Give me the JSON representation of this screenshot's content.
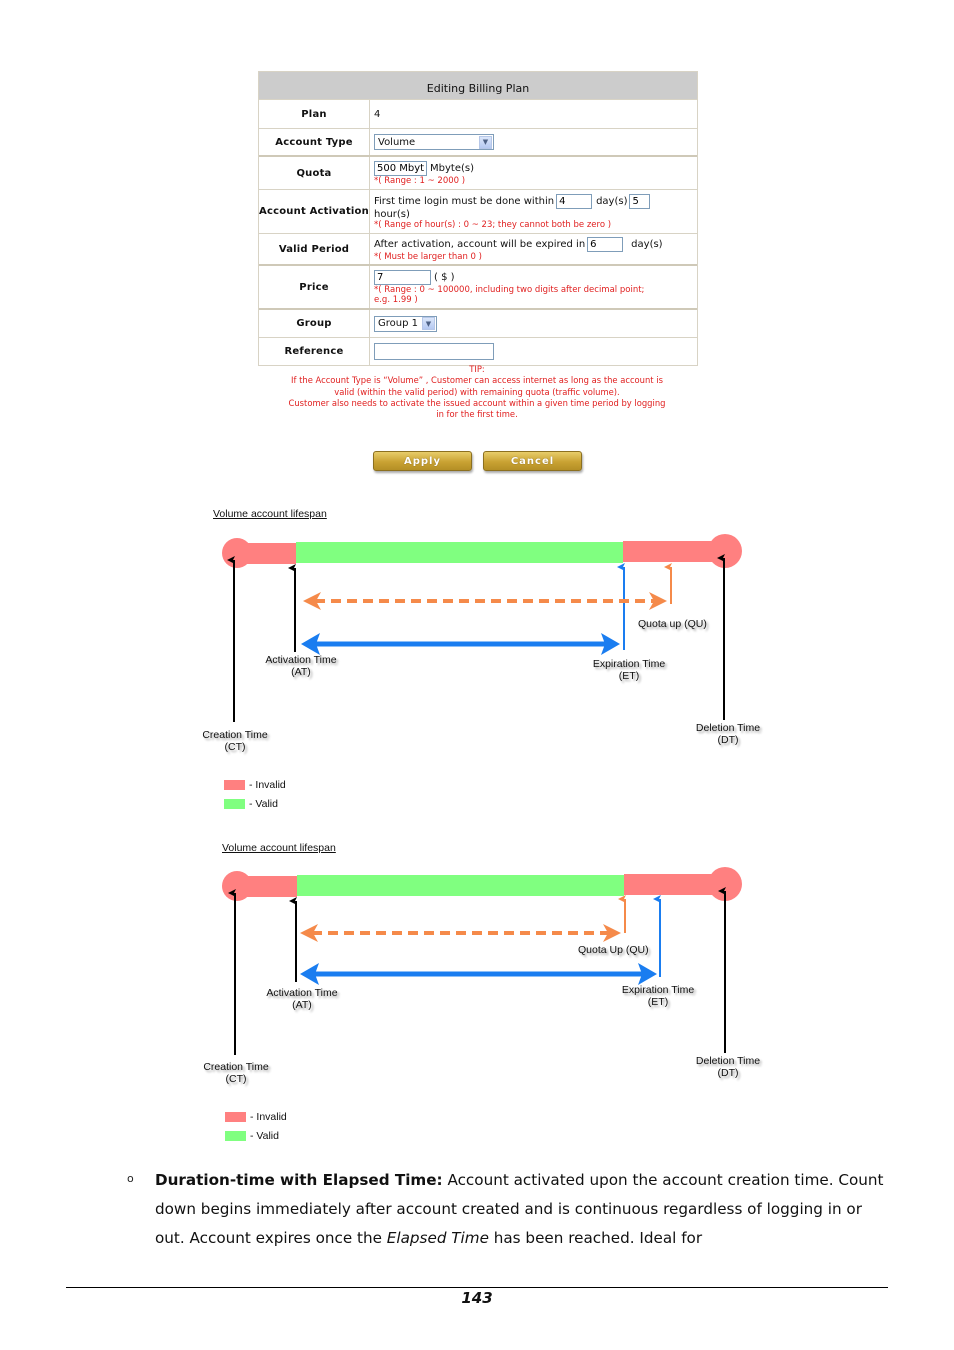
{
  "form": {
    "title": "Editing Billing Plan",
    "plan": {
      "label": "Plan",
      "value": "4"
    },
    "account_type": {
      "label": "Account Type",
      "selected": "Volume"
    },
    "quota": {
      "label": "Quota",
      "value": "500 Mbyt",
      "unit": "Mbyte(s)",
      "hint": "*( Range : 1 ~ 2000 )"
    },
    "account_activation": {
      "label": "Account Activation",
      "text_before": "First time login must be done within",
      "days_value": "4",
      "days_unit": "day(s)",
      "hours_value": "5",
      "hours_unit": "hour(s)",
      "hint": "*( Range of hour(s) : 0 ~ 23; they cannot both be zero )"
    },
    "valid_period": {
      "label": "Valid Period",
      "text_before": "After activation, account will be expired in",
      "value": "6",
      "unit": "day(s)",
      "hint": "*( Must be larger than 0 )"
    },
    "price": {
      "label": "Price",
      "value": "7",
      "unit": "( $ )",
      "hint_line1": "*( Range : 0 ~ 100000, including two digits after decimal point;",
      "hint_line2": "e.g. 1.99 )"
    },
    "group": {
      "label": "Group",
      "selected": "Group 1"
    },
    "reference": {
      "label": "Reference",
      "value": ""
    },
    "tip": {
      "heading": "TIP:",
      "line1": "If the Account Type is  “Volume” , Customer can access internet as long as the account is",
      "line2": "valid (within the valid period) with remaining quota (traffic volume).",
      "line3": "Customer also needs to activate the issued account within a given time period by logging",
      "line4": "in for the first time."
    },
    "apply_label": "Apply",
    "cancel_label": "Cancel"
  },
  "diagrams": [
    {
      "title": "Volume account lifespan",
      "labels": {
        "quota_up": "Quota up (QU)",
        "activation": "Activation Time",
        "activation_abbr": "(AT)",
        "expiration": "Expiration Time",
        "expiration_abbr": "(ET)",
        "creation": "Creation Time",
        "creation_abbr": "(CT)",
        "deletion": "Deletion Time",
        "deletion_abbr": "(DT)"
      },
      "legend": {
        "invalid": "- Invalid",
        "valid": "- Valid"
      }
    },
    {
      "title": "Volume account lifespan",
      "labels": {
        "quota_up": "Quota Up (QU)",
        "activation": "Activation Time",
        "activation_abbr": "(AT)",
        "expiration": "Expiration Time",
        "expiration_abbr": "(ET)",
        "creation": "Creation Time",
        "creation_abbr": "(CT)",
        "deletion": "Deletion Time",
        "deletion_abbr": "(DT)"
      },
      "legend": {
        "invalid": "- Invalid",
        "valid": "- Valid"
      }
    }
  ],
  "colors": {
    "invalid": "#ff8080",
    "valid": "#80ff80",
    "blue": "#1a7df0",
    "orange": "#f58a4a",
    "hint": "#e02020"
  },
  "body": {
    "bullet": "o",
    "bold_lead": "Duration-time with Elapsed Time:",
    "text1": " Account activated upon the account creation time. Count down begins immediately after account created and is continuous regardless of logging in or out. Account expires once the ",
    "italic": "Elapsed Time",
    "text2": " has been reached. Ideal for"
  },
  "footer": {
    "page_number": "143"
  }
}
